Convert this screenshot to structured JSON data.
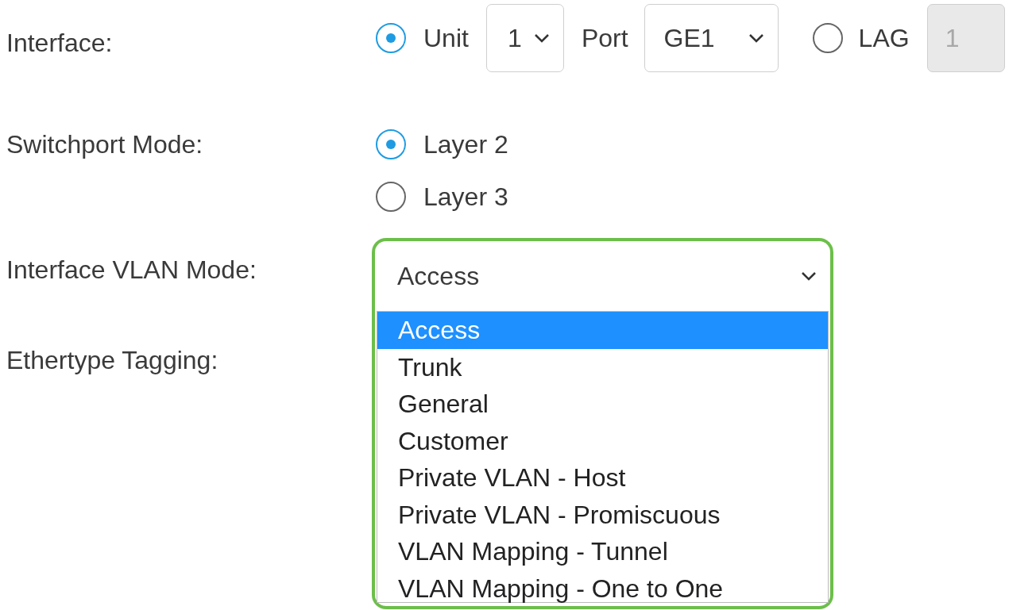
{
  "interface": {
    "label": "Interface:",
    "unit_radio": {
      "label": "Unit",
      "selected": true
    },
    "unit_select": {
      "value": "1"
    },
    "port_label": "Port",
    "port_select": {
      "value": "GE1"
    },
    "lag_radio": {
      "label": "LAG",
      "selected": false
    },
    "lag_field": {
      "value": "1",
      "disabled": true
    }
  },
  "switchport_mode": {
    "label": "Switchport Mode:",
    "options": [
      {
        "label": "Layer 2",
        "selected": true
      },
      {
        "label": "Layer 3",
        "selected": false
      }
    ]
  },
  "vlan_mode": {
    "label": "Interface VLAN Mode:",
    "value": "Access",
    "expanded": true,
    "options": [
      {
        "label": "Access",
        "selected": true
      },
      {
        "label": "Trunk",
        "selected": false
      },
      {
        "label": "General",
        "selected": false
      },
      {
        "label": "Customer",
        "selected": false
      },
      {
        "label": "Private VLAN - Host",
        "selected": false
      },
      {
        "label": "Private VLAN - Promiscuous",
        "selected": false
      },
      {
        "label": "VLAN Mapping - Tunnel",
        "selected": false
      },
      {
        "label": "VLAN Mapping - One to One",
        "selected": false
      }
    ]
  },
  "ethertype_tagging": {
    "label": "Ethertype Tagging:"
  }
}
